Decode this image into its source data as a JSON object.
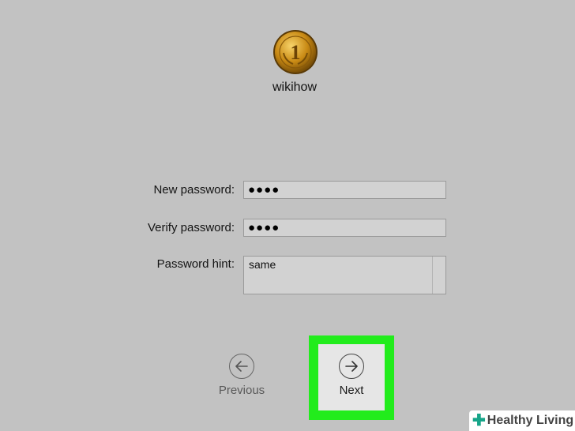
{
  "user": {
    "name": "wikihow",
    "avatar_icon": "gold-medal-icon",
    "avatar_text": "1"
  },
  "form": {
    "new_password": {
      "label": "New password:",
      "value": "●●●●"
    },
    "verify_password": {
      "label": "Verify password:",
      "value": "●●●●"
    },
    "password_hint": {
      "label": "Password hint:",
      "value": "same"
    }
  },
  "nav": {
    "previous": {
      "label": "Previous",
      "icon": "arrow-left-icon"
    },
    "next": {
      "label": "Next",
      "icon": "arrow-right-icon",
      "highlight_color": "#22ec1c"
    }
  },
  "watermark": {
    "text": "Healthy Living",
    "icon": "plus-cross-icon"
  }
}
